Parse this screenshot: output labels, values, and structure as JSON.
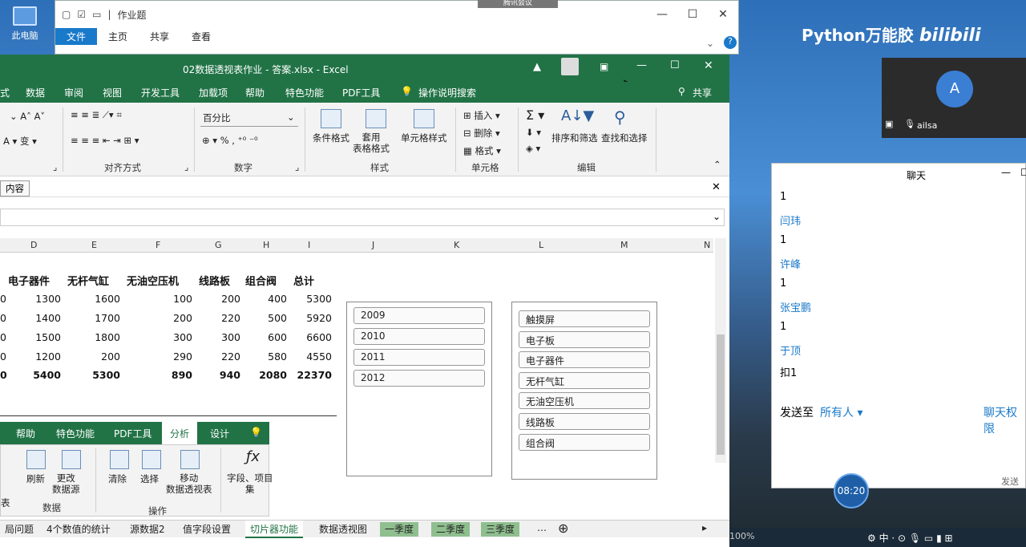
{
  "desktop": {
    "icon_label": "此电脑"
  },
  "explorer": {
    "title": "作业题",
    "tabs": [
      "文件",
      "主页",
      "共享",
      "查看"
    ]
  },
  "meeting_banner": "腾讯会议",
  "excel": {
    "title": "02数据透视表作业 - 答案.xlsx - Excel",
    "menu": [
      "式",
      "数据",
      "审阅",
      "视图",
      "开发工具",
      "加载项",
      "帮助",
      "特色功能",
      "PDF工具",
      "操作说明搜索",
      "共享"
    ],
    "ribbon": {
      "number_format": "百分比",
      "groups": [
        "对齐方式",
        "数字",
        "样式",
        "单元格",
        "编辑"
      ],
      "style_buttons": [
        "条件格式",
        "套用\n表格格式",
        "单元格样式"
      ],
      "cell_buttons": [
        "插入",
        "删除",
        "格式"
      ],
      "edit_buttons": [
        "排序和筛选",
        "查找和选择"
      ]
    },
    "infobar_button": "内容",
    "columns": [
      "D",
      "E",
      "F",
      "G",
      "H",
      "I",
      "J",
      "K",
      "L",
      "M",
      "N"
    ],
    "table": {
      "headers": [
        "电子器件",
        "无杆气缸",
        "无油空压机",
        "线路板",
        "组合阀",
        "总计"
      ],
      "rows": [
        [
          "0",
          "1300",
          "1600",
          "100",
          "200",
          "400",
          "5300"
        ],
        [
          "0",
          "1400",
          "1700",
          "200",
          "220",
          "500",
          "5920"
        ],
        [
          "0",
          "1500",
          "1800",
          "300",
          "300",
          "600",
          "6600"
        ],
        [
          "0",
          "1200",
          "200",
          "290",
          "220",
          "580",
          "4550"
        ]
      ],
      "total": [
        "0",
        "5400",
        "5300",
        "890",
        "940",
        "2080",
        "22370"
      ]
    },
    "slicer_years": [
      "2009",
      "2010",
      "2011",
      "2012"
    ],
    "slicer_products": [
      "触摸屏",
      "电子板",
      "电子器件",
      "无杆气缸",
      "无油空压机",
      "线路板",
      "组合阀"
    ],
    "pivot_tabs": [
      "帮助",
      "特色功能",
      "PDF工具",
      "分析",
      "设计"
    ],
    "pivot_buttons": [
      "刷新",
      "更改\n数据源",
      "清除",
      "选择",
      "移动\n数据透视表",
      "字段、项目\n集"
    ],
    "pivot_groups": [
      "数据",
      "操作"
    ],
    "pivot_left_edge": "表",
    "sheet_tabs": [
      "局问题",
      "4个数值的统计",
      "源数据2",
      "值字段设置",
      "切片器功能",
      "数据透视图",
      "一季度",
      "二季度",
      "三季度"
    ],
    "zoom": "100%"
  },
  "brand": {
    "text": "Python万能胶",
    "logo": "bilibili"
  },
  "video": {
    "avatar_letter": "A",
    "name": "ailsa"
  },
  "chat": {
    "title": "聊天",
    "messages": [
      {
        "text": "1"
      },
      {
        "name": "闫玮"
      },
      {
        "text": "1"
      },
      {
        "name": "许峰"
      },
      {
        "text": "1"
      },
      {
        "name": "张宝鹏"
      },
      {
        "text": "1"
      },
      {
        "name": "于顶"
      },
      {
        "text": "扣1"
      }
    ],
    "send_to_label": "发送至",
    "send_to_value": "所有人",
    "permission": "聊天权限",
    "send_button": "发送",
    "clock": "08:20"
  },
  "colors": {
    "excel_green": "#217346",
    "accent_blue": "#1979ca"
  }
}
